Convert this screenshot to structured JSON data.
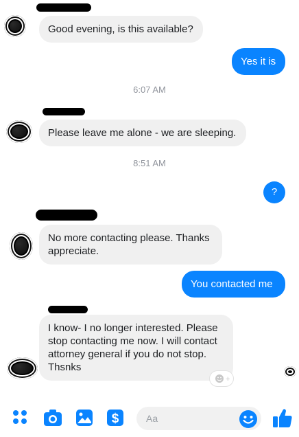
{
  "messages": [
    {
      "text": "Good evening, is this available?"
    },
    {
      "text": "Yes it is"
    },
    {
      "text": "Please leave me alone - we are sleeping."
    },
    {
      "text": "?"
    },
    {
      "text": "No more contacting please. Thanks appreciate."
    },
    {
      "text": "You contacted me"
    },
    {
      "text": "I know- I  no longer interested. Please stop contacting me now. I will contact attorney general if you do not stop. Thsnks"
    }
  ],
  "timestamps": [
    "6:07 AM",
    "8:51 AM"
  ],
  "composer": {
    "placeholder": "Aa"
  },
  "icons": [
    "menu-dots-icon",
    "camera-icon",
    "photo-icon",
    "payment-dollar-icon",
    "emoji-icon",
    "thumbs-up-icon",
    "add-reaction-icon"
  ],
  "colors": {
    "accent": "#0a84ff",
    "incoming_bubble": "#f0f0f0",
    "timestamp": "#90949c"
  }
}
